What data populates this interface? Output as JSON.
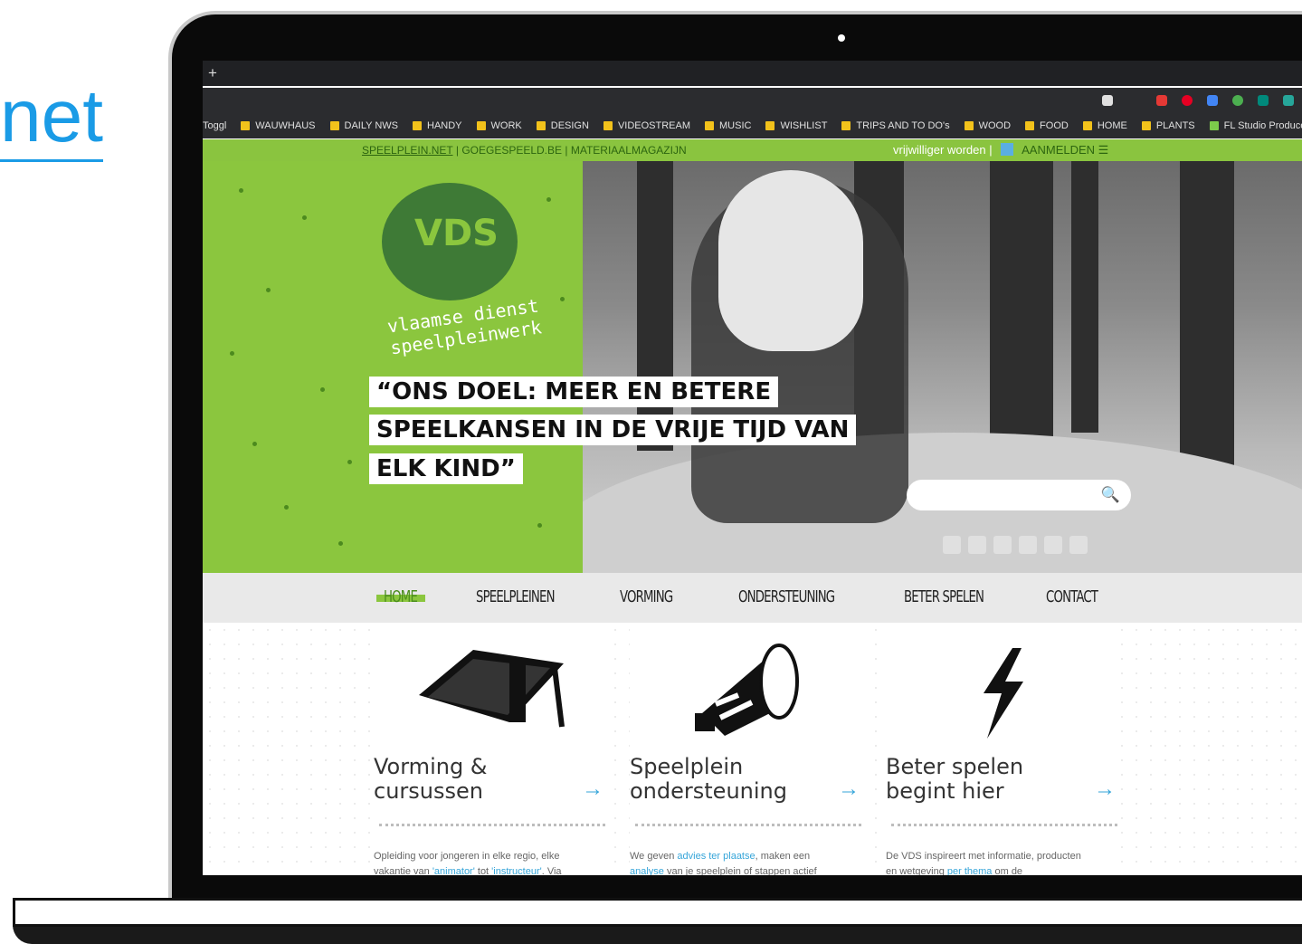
{
  "left_link": "net",
  "browser": {
    "new_tab": "+",
    "bookmarks": [
      "Toggl",
      "WAUWHAUS",
      "DAILY NWS",
      "HANDY",
      "WORK",
      "DESIGN",
      "VIDEOSTREAM",
      "MUSIC",
      "WISHLIST",
      "TRIPS AND TO DO's",
      "WOOD",
      "FOOD",
      "HOME",
      "PLANTS",
      "FL Studio Producer..."
    ]
  },
  "site": {
    "topbar": {
      "links": [
        "SPEELPLEIN.NET",
        "GOEGESPEELD.BE",
        "MATERIAALMAGAZIJN"
      ],
      "sep": "|",
      "volunteer": "vrijwilliger worden",
      "login": "AANMELDEN ☰"
    },
    "logo": {
      "mark": "VDS",
      "tagline_1": "vlaamse dienst",
      "tagline_2": "speelpleinwerk"
    },
    "hero_quote": [
      "“ONS DOEL: MEER EN BETERE",
      "SPEELKANSEN IN DE VRIJE TIJD VAN",
      "ELK KIND”"
    ],
    "search_icon_glyph": "🔍",
    "nav": [
      "HOME",
      "SPEELPLEINEN",
      "VORMING",
      "ONDERSTEUNING",
      "BETER SPELEN",
      "CONTACT"
    ],
    "cards": [
      {
        "title_1": "Vorming &",
        "title_2": "cursussen",
        "text_1": "Opleiding voor jongeren in elke regio, elke",
        "text_2a": "vakantie van ",
        "link_a": "'animator'",
        "text_2b": " tot ",
        "link_b": "'instructeur'",
        "text_2c": ". Via"
      },
      {
        "title_1": "Speelplein",
        "title_2": "ondersteuning",
        "text_1a": "We geven ",
        "link_a": "advies ter plaatse",
        "text_1b": ", maken een",
        "link_b": "analyse",
        "text_2": " van je speelplein of stappen actief"
      },
      {
        "title_1": "Beter spelen",
        "title_2": "begint hier",
        "text_1": "De VDS inspireert met informatie, producten",
        "text_2a": "en wetgeving ",
        "link_a": "per thema",
        "text_2b": " om de"
      }
    ],
    "arrow": "→"
  }
}
